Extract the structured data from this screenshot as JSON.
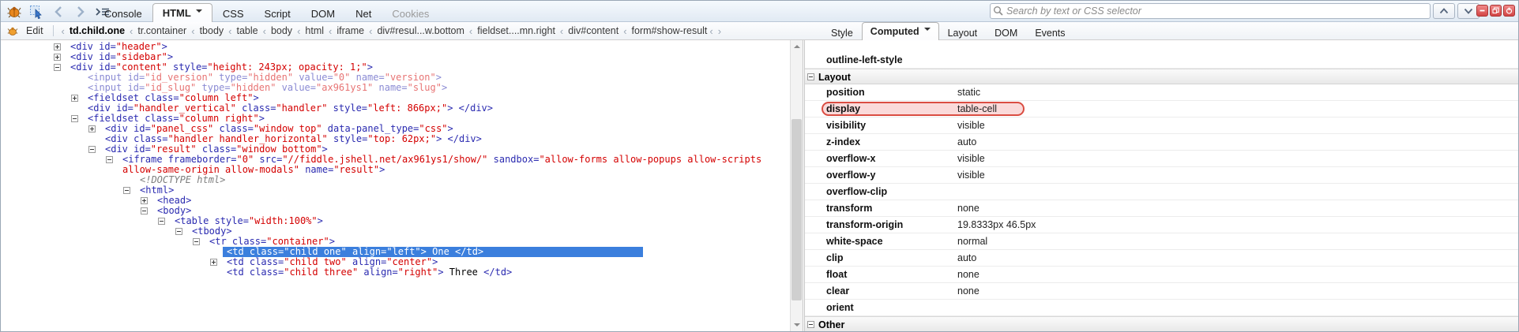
{
  "toolbar": {
    "tabs": [
      {
        "label": "Console"
      },
      {
        "label": "HTML",
        "active": true,
        "caret": true
      },
      {
        "label": "CSS"
      },
      {
        "label": "Script"
      },
      {
        "label": "DOM"
      },
      {
        "label": "Net"
      },
      {
        "label": "Cookies",
        "dim": true
      }
    ],
    "search": {
      "placeholder": "Search by text or CSS selector"
    },
    "icons": [
      "firebug-icon",
      "inspect-element-icon",
      "back-icon",
      "forward-icon",
      "command-line-icon"
    ],
    "window_buttons": [
      "minimize",
      "detach",
      "close"
    ]
  },
  "breadcrumb": {
    "edit_label": "Edit",
    "separator": "‹",
    "items": [
      "td.child.one",
      "tr.container",
      "tbody",
      "table",
      "body",
      "html",
      "iframe",
      "div#resul...w.bottom",
      "fieldset....mn.right",
      "div#content",
      "form#show-result"
    ],
    "selected_index": 0,
    "trailing_nav": [
      "‹",
      "›"
    ]
  },
  "side_tabs": [
    {
      "label": "Style"
    },
    {
      "label": "Computed",
      "active": true,
      "caret": true
    },
    {
      "label": "Layout"
    },
    {
      "label": "DOM"
    },
    {
      "label": "Events"
    }
  ],
  "tree": {
    "lines": [
      {
        "name": "tree-node-div-header",
        "indent": 0,
        "twisty": "+",
        "segs": [
          [
            "g",
            "<div id="
          ],
          [
            "v",
            "\"header\""
          ],
          [
            "g",
            ">"
          ]
        ]
      },
      {
        "name": "tree-node-div-sidebar",
        "indent": 0,
        "twisty": "+",
        "segs": [
          [
            "g",
            "<div id="
          ],
          [
            "v",
            "\"sidebar\""
          ],
          [
            "g",
            ">"
          ]
        ]
      },
      {
        "name": "tree-node-div-content",
        "indent": 0,
        "twisty": "-",
        "segs": [
          [
            "g",
            "<div id="
          ],
          [
            "v",
            "\"content\""
          ],
          [
            "g",
            " style="
          ],
          [
            "v",
            "\"height: 243px; opacity: 1;\""
          ],
          [
            "g",
            ">"
          ]
        ]
      },
      {
        "name": "tree-node-input-id-version",
        "indent": 1,
        "twisty": "",
        "muted": true,
        "segs": [
          [
            "g",
            "<input id="
          ],
          [
            "v",
            "\"id_version\""
          ],
          [
            "g",
            " type="
          ],
          [
            "v",
            "\"hidden\""
          ],
          [
            "g",
            " value="
          ],
          [
            "v",
            "\"0\""
          ],
          [
            "g",
            " name="
          ],
          [
            "v",
            "\"version\""
          ],
          [
            "g",
            ">"
          ]
        ]
      },
      {
        "name": "tree-node-input-id-slug",
        "indent": 1,
        "twisty": "",
        "muted": true,
        "segs": [
          [
            "g",
            "<input id="
          ],
          [
            "v",
            "\"id_slug\""
          ],
          [
            "g",
            " type="
          ],
          [
            "v",
            "\"hidden\""
          ],
          [
            "g",
            " value="
          ],
          [
            "v",
            "\"ax961ys1\""
          ],
          [
            "g",
            " name="
          ],
          [
            "v",
            "\"slug\""
          ],
          [
            "g",
            ">"
          ]
        ]
      },
      {
        "name": "tree-node-fieldset-column-left",
        "indent": 1,
        "twisty": "+",
        "segs": [
          [
            "g",
            "<fieldset class="
          ],
          [
            "v",
            "\"column left\""
          ],
          [
            "g",
            ">"
          ]
        ]
      },
      {
        "name": "tree-node-div-handler-vertical",
        "indent": 1,
        "twisty": "",
        "segs": [
          [
            "g",
            "<div id="
          ],
          [
            "v",
            "\"handler_vertical\""
          ],
          [
            "g",
            " class="
          ],
          [
            "v",
            "\"handler\""
          ],
          [
            "g",
            " style="
          ],
          [
            "v",
            "\"left: 866px;\""
          ],
          [
            "g",
            ">"
          ],
          [
            "t",
            " "
          ],
          [
            "g",
            "</div>"
          ]
        ]
      },
      {
        "name": "tree-node-fieldset-column-right",
        "indent": 1,
        "twisty": "-",
        "segs": [
          [
            "g",
            "<fieldset class="
          ],
          [
            "v",
            "\"column right\""
          ],
          [
            "g",
            ">"
          ]
        ]
      },
      {
        "name": "tree-node-div-panel-css",
        "indent": 2,
        "twisty": "+",
        "segs": [
          [
            "g",
            "<div id="
          ],
          [
            "v",
            "\"panel_css\""
          ],
          [
            "g",
            " class="
          ],
          [
            "v",
            "\"window top\""
          ],
          [
            "g",
            " data-panel_type="
          ],
          [
            "v",
            "\"css\""
          ],
          [
            "g",
            ">"
          ]
        ]
      },
      {
        "name": "tree-node-div-handler-horizontal",
        "indent": 2,
        "twisty": "",
        "segs": [
          [
            "g",
            "<div class="
          ],
          [
            "v",
            "\"handler handler_horizontal\""
          ],
          [
            "g",
            " style="
          ],
          [
            "v",
            "\"top: 62px;\""
          ],
          [
            "g",
            ">"
          ],
          [
            "t",
            " "
          ],
          [
            "g",
            "</div>"
          ]
        ]
      },
      {
        "name": "tree-node-div-result",
        "indent": 2,
        "twisty": "-",
        "segs": [
          [
            "g",
            "<div id="
          ],
          [
            "v",
            "\"result\""
          ],
          [
            "g",
            " class="
          ],
          [
            "v",
            "\"window bottom\""
          ],
          [
            "g",
            ">"
          ]
        ]
      },
      {
        "name": "tree-node-iframe",
        "indent": 3,
        "twisty": "-",
        "segs": [
          [
            "g",
            "<iframe frameborder="
          ],
          [
            "v",
            "\"0\""
          ],
          [
            "g",
            " src="
          ],
          [
            "v",
            "\"//fiddle.jshell.net/ax961ys1/show/\""
          ],
          [
            "g",
            " sandbox="
          ],
          [
            "v",
            "\"allow-forms allow-popups allow-scripts"
          ]
        ]
      },
      {
        "name": "tree-node-iframe-wrap",
        "indent": 3,
        "twisty": "",
        "segs": [
          [
            "v",
            "allow-same-origin allow-modals\""
          ],
          [
            "g",
            " name="
          ],
          [
            "v",
            "\"result\""
          ],
          [
            "g",
            ">"
          ]
        ]
      },
      {
        "name": "tree-node-doctype",
        "indent": 4,
        "twisty": "",
        "segs": [
          [
            "d",
            "<!DOCTYPE html>"
          ]
        ]
      },
      {
        "name": "tree-node-html",
        "indent": 4,
        "twisty": "-",
        "segs": [
          [
            "g",
            "<html>"
          ]
        ]
      },
      {
        "name": "tree-node-head",
        "indent": 5,
        "twisty": "+",
        "segs": [
          [
            "g",
            "<head>"
          ]
        ]
      },
      {
        "name": "tree-node-body",
        "indent": 5,
        "twisty": "-",
        "segs": [
          [
            "g",
            "<body>"
          ]
        ]
      },
      {
        "name": "tree-node-table",
        "indent": 6,
        "twisty": "-",
        "segs": [
          [
            "g",
            "<table style="
          ],
          [
            "v",
            "\"width:100%\""
          ],
          [
            "g",
            ">"
          ]
        ]
      },
      {
        "name": "tree-node-tbody",
        "indent": 7,
        "twisty": "-",
        "segs": [
          [
            "g",
            "<tbody>"
          ]
        ]
      },
      {
        "name": "tree-node-tr-container",
        "indent": 8,
        "twisty": "-",
        "segs": [
          [
            "g",
            "<tr class="
          ],
          [
            "v",
            "\"container\""
          ],
          [
            "g",
            ">"
          ]
        ]
      },
      {
        "name": "tree-node-td-child-one",
        "indent": 9,
        "twisty": "",
        "selected": true,
        "segs": [
          [
            "g",
            "<td class="
          ],
          [
            "v",
            "\"child one\""
          ],
          [
            "g",
            " align="
          ],
          [
            "v",
            "\"left\""
          ],
          [
            "g",
            ">"
          ],
          [
            "t",
            " One "
          ],
          [
            "g",
            "</td>"
          ]
        ]
      },
      {
        "name": "tree-node-td-child-two",
        "indent": 9,
        "twisty": "+",
        "segs": [
          [
            "g",
            "<td class="
          ],
          [
            "v",
            "\"child two\""
          ],
          [
            "g",
            " align="
          ],
          [
            "v",
            "\"center\""
          ],
          [
            "g",
            ">"
          ]
        ]
      },
      {
        "name": "tree-node-td-child-three",
        "indent": 9,
        "twisty": "",
        "segs": [
          [
            "g",
            "<td class="
          ],
          [
            "v",
            "\"child three\""
          ],
          [
            "g",
            " align="
          ],
          [
            "v",
            "\"right\""
          ],
          [
            "g",
            ">"
          ],
          [
            "t",
            " Three "
          ],
          [
            "g",
            "</td>"
          ]
        ]
      }
    ]
  },
  "computed": {
    "partial_row": {
      "name": "outline-left-style",
      "value": ""
    },
    "group": "Layout",
    "rows": [
      {
        "name": "position",
        "value": "static"
      },
      {
        "name": "display",
        "value": "table-cell",
        "highlighted": true
      },
      {
        "name": "visibility",
        "value": "visible"
      },
      {
        "name": "z-index",
        "value": "auto"
      },
      {
        "name": "overflow-x",
        "value": "visible"
      },
      {
        "name": "overflow-y",
        "value": "visible"
      },
      {
        "name": "overflow-clip",
        "value": ""
      },
      {
        "name": "transform",
        "value": "none"
      },
      {
        "name": "transform-origin",
        "value": "19.8333px 46.5px"
      },
      {
        "name": "white-space",
        "value": "normal"
      },
      {
        "name": "clip",
        "value": "auto"
      },
      {
        "name": "float",
        "value": "none"
      },
      {
        "name": "clear",
        "value": "none"
      },
      {
        "name": "orient",
        "value": ""
      }
    ],
    "next_group": "Other"
  },
  "colors": {
    "selection_blue": "#3b7fdd",
    "tag_blue": "#2a2ab0",
    "value_red": "#d40000",
    "highlight_red_border": "#da4d42",
    "highlight_red_bg": "#fadada"
  }
}
